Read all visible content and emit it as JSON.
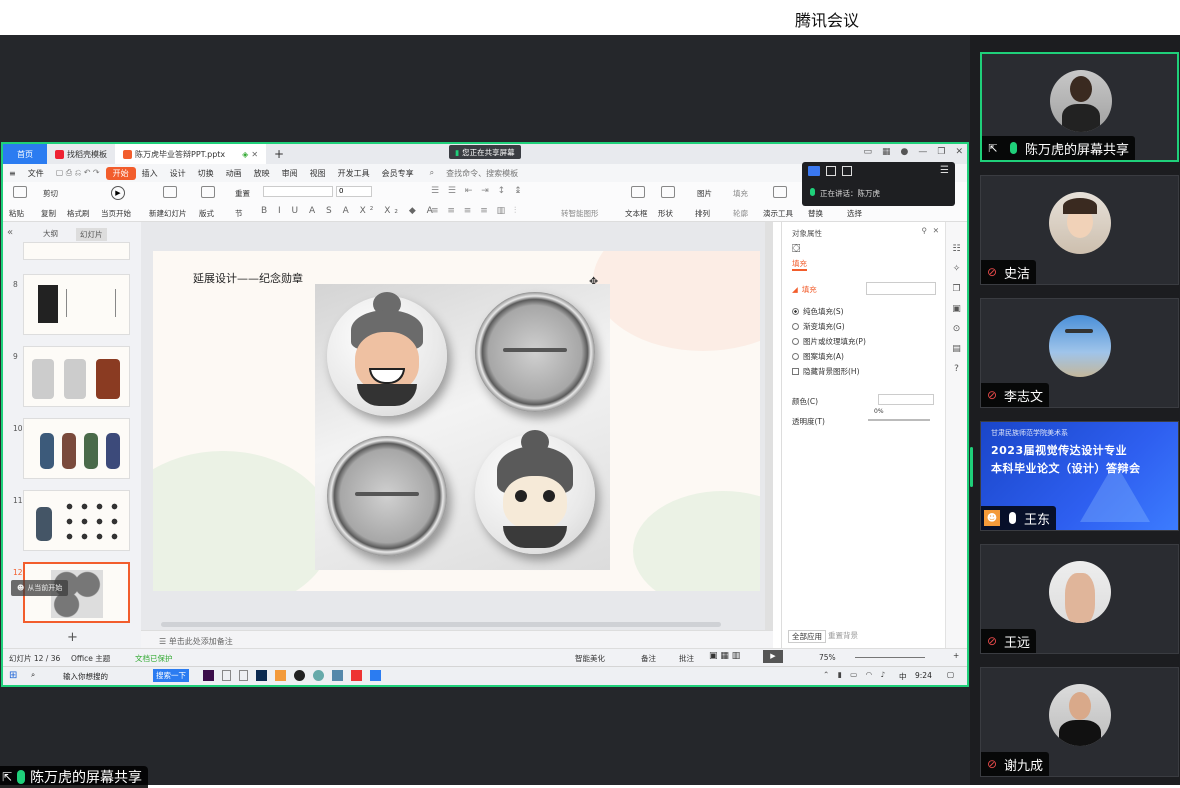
{
  "app": {
    "title": "腾讯会议"
  },
  "share": {
    "indicator": "您正在共享屏幕",
    "bottom_label": "陈万虎的屏幕共享"
  },
  "wps": {
    "tabs": [
      {
        "label": "首页"
      },
      {
        "label": "找稻壳模板"
      },
      {
        "label": "陈万虎毕业答辩PPT.pptx"
      }
    ],
    "menu": [
      "文件",
      "开始",
      "插入",
      "设计",
      "切换",
      "动画",
      "放映",
      "审阅",
      "视图",
      "开发工具",
      "会员专享"
    ],
    "search_placeholder": "查找命令、搜索模板",
    "ribbon": {
      "paste": "粘贴",
      "cut": "剪切",
      "copy": "复制",
      "format_painter": "格式刷",
      "from_current": "当页开始",
      "new_slide": "新建幻灯片",
      "layout": "版式",
      "section": "节",
      "reset": "重置",
      "text_box": "文本框",
      "shape": "形状",
      "arrange": "排列",
      "picture": "图片",
      "fill": "填充",
      "outline": "轮廓",
      "presentation_tools": "演示工具",
      "replace": "替换",
      "select": "选择",
      "convert_art": "转智能图形",
      "font_size": "0"
    },
    "meeting_float": {
      "speaking": "正在讲话：陈万虎"
    },
    "left_panel": {
      "tabs": [
        "大纲",
        "幻灯片"
      ],
      "thumbnails": [
        {
          "num": "8"
        },
        {
          "num": "9"
        },
        {
          "num": "10"
        },
        {
          "num": "11"
        },
        {
          "num": "12"
        }
      ],
      "hover_text": "从当前开始"
    },
    "slide": {
      "title": "延展设计——纪念勋章"
    },
    "notes_placeholder": "单击此处添加备注",
    "props": {
      "header": "对象属性",
      "tab": "填充",
      "section": "填充",
      "options": [
        "纯色填充(S)",
        "渐变填充(G)",
        "图片或纹理填充(P)",
        "图案填充(A)"
      ],
      "checkbox": "隐藏背景图形(H)",
      "color_label": "颜色(C)",
      "transparency_label": "透明度(T)",
      "transparency_value": "0%",
      "apply_all": "全部应用",
      "reset_bg": "重置背景"
    },
    "status": {
      "slide_count": "幻灯片 12 / 36",
      "theme": "Office 主题",
      "doc_status": "文档已保护",
      "beautify": "智能美化",
      "notes": "备注",
      "comment": "批注",
      "zoom": "75%"
    },
    "taskbar": {
      "search_placeholder": "输入你想搜的",
      "search_btn": "搜索一下",
      "ime": "中",
      "time": "9:24"
    }
  },
  "participants": [
    {
      "name": "陈万虎的屏幕共享",
      "mic": "on",
      "screen": true
    },
    {
      "name": "史洁",
      "mic": "off"
    },
    {
      "name": "李志文",
      "mic": "off"
    },
    {
      "name": "王东",
      "mic": "on",
      "banner": {
        "line1": "甘肃民族师范学院美术系",
        "line2": "2023届视觉传达设计专业",
        "line3": "本科毕业论文（设计）答辩会"
      }
    },
    {
      "name": "王远",
      "mic": "off"
    },
    {
      "name": "谢九成",
      "mic": "off"
    }
  ],
  "colors": {
    "accent_green": "#1fd07a",
    "wps_orange": "#f25d2c",
    "tab_blue": "#2b7cf1"
  }
}
